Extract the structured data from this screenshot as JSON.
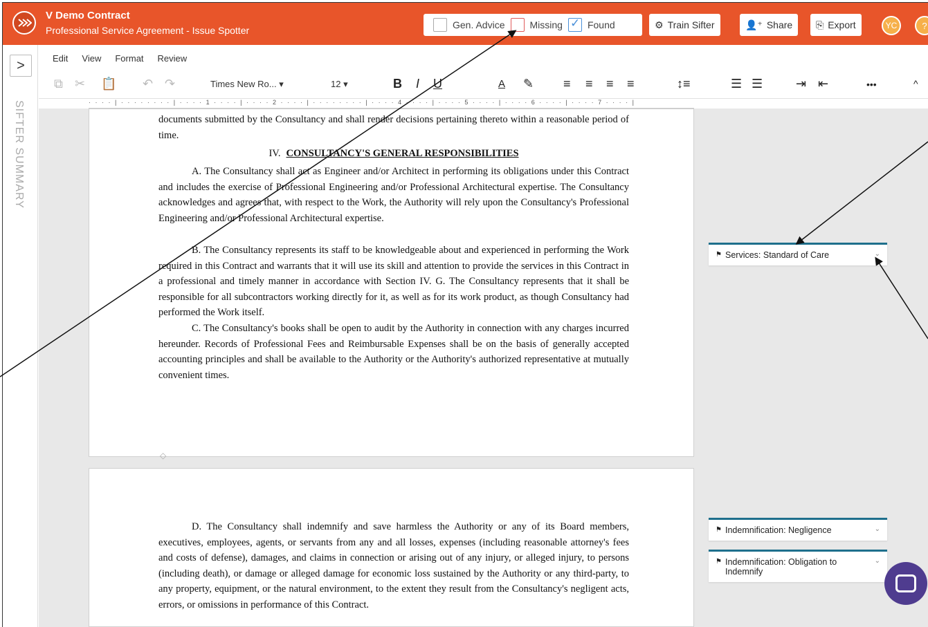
{
  "header": {
    "title": "V Demo Contract",
    "subtitle": "Professional Service Agreement - Issue Spotter",
    "filters": {
      "gen_advice": "Gen. Advice",
      "missing": "Missing",
      "found": "Found"
    },
    "train_label": "Train Sifter",
    "share_label": "Share",
    "export_label": "Export",
    "avatar_initials": "YC",
    "help_label": "?"
  },
  "sidebar": {
    "toggle": ">",
    "label": "SIFTER SUMMARY"
  },
  "menu": {
    "items": [
      "Edit",
      "View",
      "Format",
      "Review"
    ]
  },
  "toolbar": {
    "font": "Times New Ro...",
    "size": "12",
    "bold": "B",
    "italic": "I",
    "underline": "U",
    "font_color": "A",
    "more": "•••"
  },
  "ruler": {
    "text": "· · · · | · · · ·   · · · · | · · · · 1 · · · · | · · · · 2 · · · · | · · · ·  · · · · | · · · · 4 · · · · | · · · · 5 · · · · | · · · · 6 · · · · | · · · · 7 · · · · |"
  },
  "document": {
    "page1": {
      "intro": "documents submitted by the Consultancy and shall render decisions pertaining thereto within a reasonable period of time.",
      "heading_num": "IV.",
      "heading": "CONSULTANCY'S GENERAL RESPONSIBILITIES",
      "para_a": "A.      The Consultancy shall act as Engineer and/or Architect in performing its obligations under this Contract and includes the exercise of Professional Engineering and/or Professional Architectural expertise. The Consultancy acknowledges and agrees that, with respect to the Work, the Authority will rely upon the Consultancy's Professional Engineering and/or Professional Architectural expertise.",
      "para_b": "B.      The Consultancy represents its staff to be knowledgeable about and experienced in performing the Work required in this Contract and warrants that it will use its skill and attention to provide the services in this Contract in a professional and timely manner in accordance with Section IV. G. The Consultancy represents that it shall be responsible for all subcontractors working directly for it, as well as for its work product, as though Consultancy had performed the Work itself.",
      "para_c": "C.      The Consultancy's books shall be open to audit by the Authority in connection with any charges incurred hereunder. Records of Professional Fees and Reimbursable Expenses shall be on the basis of generally accepted accounting principles and shall be available to the Authority or the Authority's authorized representative at mutually convenient times."
    },
    "page2": {
      "para_d": "D.      The Consultancy shall indemnify and save harmless the Authority or any of its Board members, executives, employees, agents, or servants from any and all losses, expenses (including reasonable attorney's fees and costs of defense), damages, and claims in connection or arising out of any injury, or alleged injury, to persons (including death), or damage or alleged damage for economic loss sustained by the Authority or any third-party, to any property, equipment, or the natural environment, to the extent they result from the Consultancy's negligent acts, errors, or omissions in performance of this Contract."
    }
  },
  "cards": [
    {
      "label": "Services: Standard of Care"
    },
    {
      "label": "Indemnification: Negligence"
    },
    {
      "label": "Indemnification: Obligation to Indemnify"
    }
  ],
  "colors": {
    "header": "#e8552a",
    "card_border": "#1e6f8c",
    "chat": "#4f3c8f"
  }
}
